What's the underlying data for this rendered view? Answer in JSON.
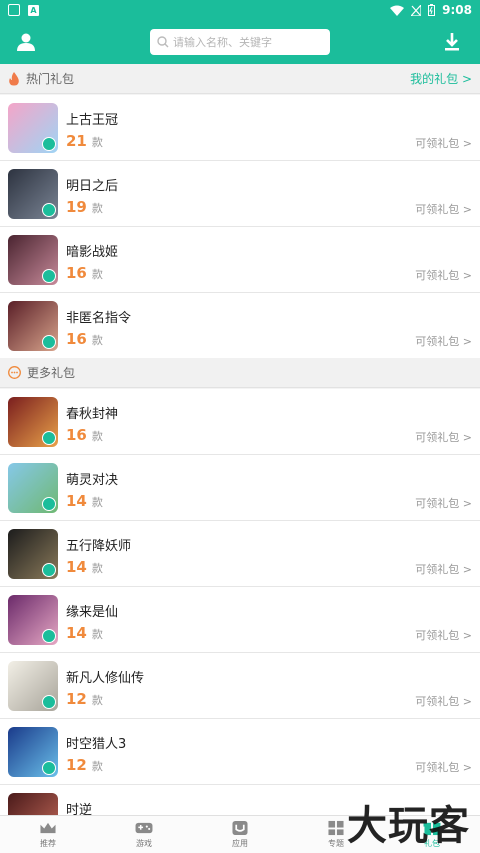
{
  "status": {
    "time": "9:08"
  },
  "search": {
    "placeholder": "请输入名称、关键字"
  },
  "hot": {
    "title": "热门礼包",
    "mine_link": "我的礼包 >",
    "items": [
      {
        "name": "上古王冠",
        "count": "21",
        "unit": "款",
        "get": "可领礼包 >",
        "c1": "#f4a5c8",
        "c2": "#9fd4f4"
      },
      {
        "name": "明日之后",
        "count": "19",
        "unit": "款",
        "get": "可领礼包 >",
        "c1": "#2d3340",
        "c2": "#7a8494"
      },
      {
        "name": "暗影战姬",
        "count": "16",
        "unit": "款",
        "get": "可领礼包 >",
        "c1": "#4a2430",
        "c2": "#c78a9a"
      },
      {
        "name": "非匿名指令",
        "count": "16",
        "unit": "款",
        "get": "可领礼包 >",
        "c1": "#5a1f28",
        "c2": "#d8a48c"
      }
    ]
  },
  "more": {
    "title": "更多礼包",
    "items": [
      {
        "name": "春秋封神",
        "count": "16",
        "unit": "款",
        "get": "可领礼包 >",
        "c1": "#7a1e1e",
        "c2": "#e9a24a"
      },
      {
        "name": "萌灵对决",
        "count": "14",
        "unit": "款",
        "get": "可领礼包 >",
        "c1": "#86c8e8",
        "c2": "#6fb872"
      },
      {
        "name": "五行降妖师",
        "count": "14",
        "unit": "款",
        "get": "可领礼包 >",
        "c1": "#1c1c1c",
        "c2": "#8a7a5a"
      },
      {
        "name": "缘来是仙",
        "count": "14",
        "unit": "款",
        "get": "可领礼包 >",
        "c1": "#6b2a6a",
        "c2": "#e6a8c4"
      },
      {
        "name": "新凡人修仙传",
        "count": "12",
        "unit": "款",
        "get": "可领礼包 >",
        "c1": "#f2efe6",
        "c2": "#a8a49a"
      },
      {
        "name": "时空猎人3",
        "count": "12",
        "unit": "款",
        "get": "可领礼包 >",
        "c1": "#1a3a8a",
        "c2": "#6ac0ea"
      },
      {
        "name": "时逆",
        "count": "",
        "unit": "",
        "get": "",
        "c1": "#4a1a1a",
        "c2": "#c46a5a"
      }
    ]
  },
  "tabs": [
    {
      "label": "推荐",
      "icon": "crown-icon"
    },
    {
      "label": "游戏",
      "icon": "gamepad-icon"
    },
    {
      "label": "应用",
      "icon": "app-icon"
    },
    {
      "label": "专题",
      "icon": "grid-icon"
    },
    {
      "label": "礼包",
      "icon": "gift-icon",
      "active": true
    }
  ],
  "watermark": "大玩客",
  "colors": {
    "accent": "#1bbd9b",
    "count": "#f08a3c"
  }
}
